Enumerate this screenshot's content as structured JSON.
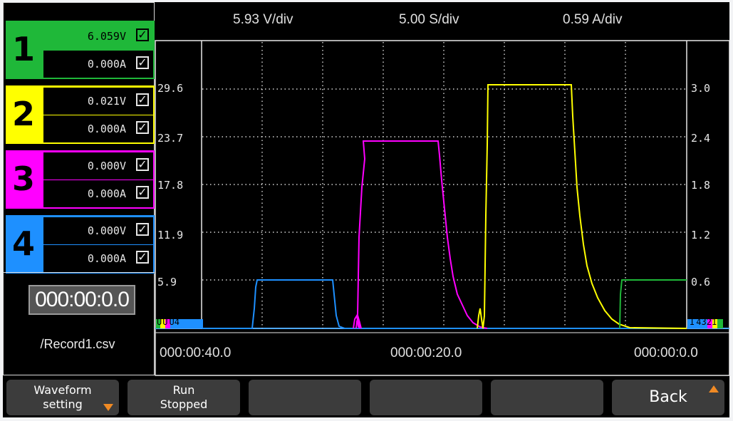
{
  "channels": [
    {
      "num": "1",
      "color": "#1fb839",
      "voltage": "6.059V",
      "current": "0.000A",
      "v_checked": "✓",
      "i_checked": "✓",
      "v_bg": "#1fb839"
    },
    {
      "num": "2",
      "color": "#ffff00",
      "voltage": "0.021V",
      "current": "0.000A",
      "v_checked": "✓",
      "i_checked": "✓"
    },
    {
      "num": "3",
      "color": "#ff00ff",
      "voltage": "0.000V",
      "current": "0.000A",
      "v_checked": "✓",
      "i_checked": "✓"
    },
    {
      "num": "4",
      "color": "#1e90ff",
      "voltage": "0.000V",
      "current": "0.000A",
      "v_checked": "✓",
      "i_checked": "✓"
    }
  ],
  "timer": "000:00:0.0",
  "file": "/Record1.csv",
  "header": {
    "vdiv": "5.93 V/div",
    "sdiv": "5.00 S/div",
    "adiv": "0.59 A/div"
  },
  "left_axis": [
    "29.6",
    "23.7",
    "17.8",
    "11.9",
    "5.9"
  ],
  "right_axis": [
    "3.0",
    "2.4",
    "1.8",
    "1.2",
    "0.6"
  ],
  "time_axis": [
    "000:00:40.0",
    "000:00:20.0",
    "000:00:0.0"
  ],
  "left_marker": [
    "U",
    "U",
    "U",
    "4"
  ],
  "right_marker": [
    "I",
    "4",
    "3",
    "2",
    "1"
  ],
  "softkeys": [
    {
      "line1": "Waveform",
      "line2": "setting"
    },
    {
      "line1": "Run",
      "line2": "Stopped"
    },
    {
      "line1": "",
      "line2": ""
    },
    {
      "line1": "",
      "line2": ""
    },
    {
      "line1": "",
      "line2": ""
    },
    {
      "line1": "Back",
      "line2": ""
    }
  ],
  "colors": {
    "ch1": "#1fb839",
    "ch2": "#ffff00",
    "ch3": "#ff00ff",
    "ch4": "#1e90ff",
    "screen_bg": "#000000",
    "grid": "#ffffff"
  }
}
